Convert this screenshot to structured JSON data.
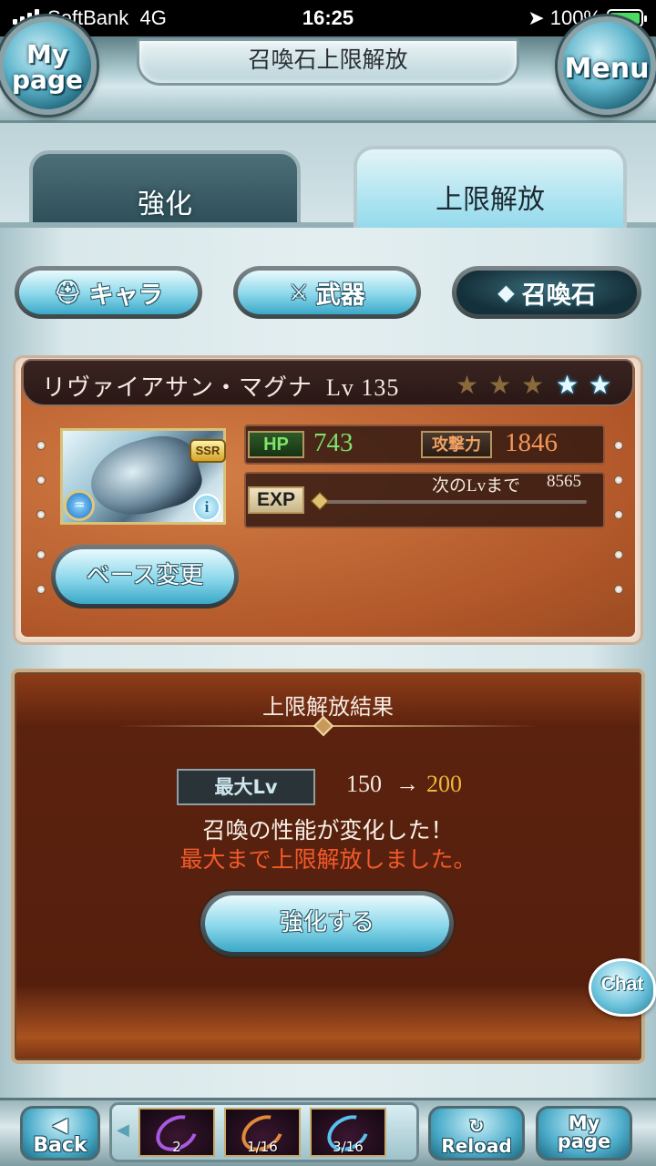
{
  "status_bar": {
    "carrier": "SoftBank",
    "network": "4G",
    "time": "16:25",
    "battery": "100%"
  },
  "header": {
    "title": "召喚石上限解放",
    "mypage_label": [
      "My",
      "page"
    ],
    "menu_label": "Menu"
  },
  "tabs": {
    "enhance": "強化",
    "uncap": "上限解放",
    "active": "uncap"
  },
  "categories": {
    "chara": "キャラ",
    "weapon": "武器",
    "summon": "召喚石",
    "active": "summon"
  },
  "summon": {
    "name": "リヴァイアサン・マグナ",
    "level_text": "Lv 135",
    "rarity": "SSR",
    "stars_total": 5,
    "stars_gold": 3,
    "stars_blue": 2,
    "element": "water",
    "hp_label": "HP",
    "hp": "743",
    "atk_label": "攻撃力",
    "atk": "1846",
    "exp_label": "EXP",
    "exp_next_label": "次のLvまで",
    "exp_next_value": "8565",
    "exp_progress": 0.0,
    "base_change_label": "ベース変更"
  },
  "result": {
    "title": "上限解放結果",
    "max_lv_label": "最大Lv",
    "old_max": "150",
    "arrow": "→",
    "new_max": "200",
    "message": "召喚の性能が変化した！",
    "message_highlight": "最大まで上限解放しました。",
    "enhance_button": "強化する"
  },
  "chat_label": "Chat",
  "bottom_nav": {
    "back": "Back",
    "reload": "Reload",
    "mypage": [
      "My",
      "page"
    ],
    "quests": [
      {
        "count": "2"
      },
      {
        "count": "1/16"
      },
      {
        "count": "3/16"
      }
    ]
  },
  "colors": {
    "hp": "#7ee06a",
    "atk": "#f59555",
    "new_max": "#f0b63a",
    "highlight": "#f35a2a",
    "accent_blue": "#3aa8c8"
  }
}
